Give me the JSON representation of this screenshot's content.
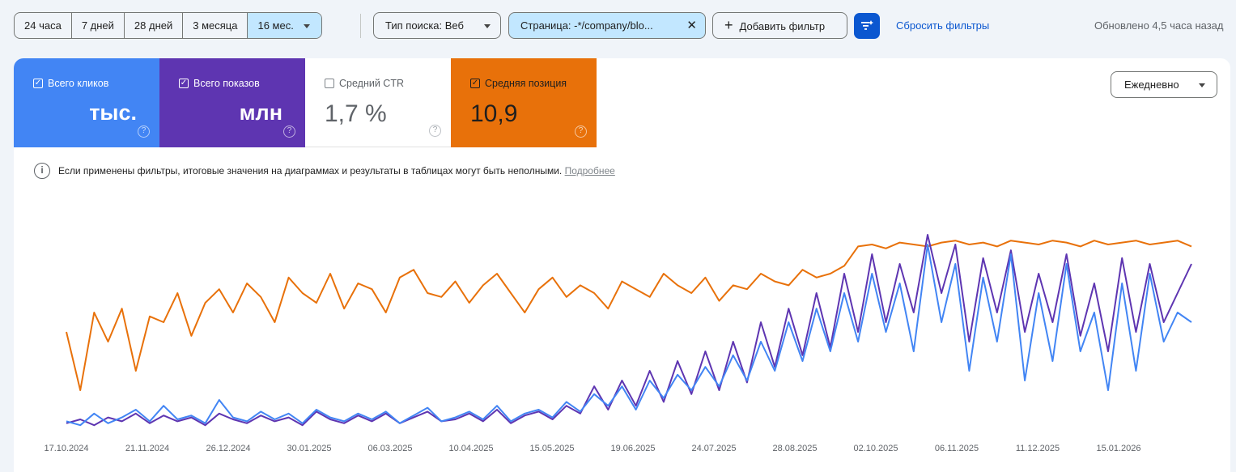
{
  "date_ranges": [
    "24 часа",
    "7 дней",
    "28 дней",
    "3 месяца",
    "16 мес."
  ],
  "filters": {
    "search_type": "Тип поиска: Веб",
    "page": "Страница: -*/company/blo...",
    "page_close": "✕",
    "add": "Добавить фильтр",
    "add_icon": "+",
    "reset": "Сбросить фильтры"
  },
  "updated": "Обновлено 4,5 часа назад",
  "cards": [
    {
      "label": "Всего кликов",
      "value": "тыс.",
      "checked": true,
      "color": "#4285f4"
    },
    {
      "label": "Всего показов",
      "value": "млн",
      "checked": true,
      "color": "#5e35b1"
    },
    {
      "label": "Средний CTR",
      "value": "1,7 %",
      "checked": false,
      "color": "#ffffff"
    },
    {
      "label": "Средняя позиция",
      "value": "10,9",
      "checked": true,
      "color": "#e8710a"
    }
  ],
  "help_glyph": "?",
  "check_glyph": "✓",
  "granularity": "Ежедневно",
  "info": {
    "icon": "i",
    "text": "Если применены фильтры, итоговые значения на диаграммах и результаты в таблицах могут быть неполными.",
    "link": "Подробнее"
  },
  "chart_data": {
    "type": "line",
    "x_ticks": [
      "17.10.2024",
      "21.11.2024",
      "26.12.2024",
      "30.01.2025",
      "06.03.2025",
      "10.04.2025",
      "15.05.2025",
      "19.06.2025",
      "24.07.2025",
      "28.08.2025",
      "02.10.2025",
      "06.11.2025",
      "11.12.2025",
      "15.01.2026"
    ],
    "y_range": [
      0,
      100
    ],
    "series": [
      {
        "name": "Средняя позиция",
        "color": "#e8710a",
        "values": [
          50,
          20,
          60,
          45,
          62,
          30,
          58,
          55,
          70,
          48,
          65,
          72,
          60,
          75,
          68,
          55,
          78,
          70,
          65,
          80,
          62,
          75,
          72,
          60,
          78,
          82,
          70,
          68,
          76,
          65,
          74,
          80,
          70,
          60,
          72,
          78,
          68,
          74,
          70,
          62,
          76,
          72,
          68,
          80,
          74,
          70,
          78,
          66,
          74,
          72,
          80,
          76,
          74,
          82,
          78,
          80,
          84,
          94,
          95,
          93,
          96,
          95,
          94,
          96,
          97,
          95,
          96,
          94,
          97,
          96,
          95,
          97,
          96,
          94,
          97,
          95,
          96,
          97,
          95,
          96,
          97,
          94
        ]
      },
      {
        "name": "Всего показов",
        "color": "#5e35b1",
        "values": [
          3,
          5,
          2,
          6,
          4,
          8,
          3,
          7,
          4,
          6,
          2,
          8,
          5,
          3,
          7,
          4,
          6,
          2,
          9,
          5,
          3,
          7,
          4,
          8,
          3,
          6,
          9,
          4,
          5,
          8,
          4,
          10,
          3,
          7,
          9,
          5,
          12,
          8,
          22,
          10,
          25,
          12,
          30,
          14,
          35,
          18,
          40,
          20,
          45,
          24,
          55,
          32,
          62,
          38,
          70,
          42,
          80,
          50,
          90,
          55,
          85,
          60,
          100,
          70,
          95,
          45,
          88,
          60,
          92,
          50,
          80,
          55,
          90,
          48,
          75,
          40,
          88,
          50,
          85,
          55,
          70,
          85
        ]
      },
      {
        "name": "Всего кликов",
        "color": "#4285f4",
        "values": [
          4,
          2,
          8,
          3,
          6,
          10,
          4,
          12,
          5,
          7,
          3,
          15,
          6,
          4,
          9,
          5,
          8,
          3,
          10,
          6,
          4,
          8,
          5,
          9,
          3,
          7,
          11,
          4,
          6,
          9,
          5,
          12,
          4,
          8,
          10,
          6,
          14,
          9,
          18,
          12,
          22,
          10,
          25,
          16,
          28,
          20,
          32,
          22,
          38,
          25,
          45,
          30,
          55,
          35,
          62,
          40,
          70,
          45,
          80,
          50,
          75,
          40,
          95,
          55,
          85,
          30,
          78,
          45,
          90,
          25,
          70,
          35,
          85,
          40,
          60,
          20,
          75,
          30,
          80,
          45,
          60,
          55
        ]
      }
    ]
  }
}
